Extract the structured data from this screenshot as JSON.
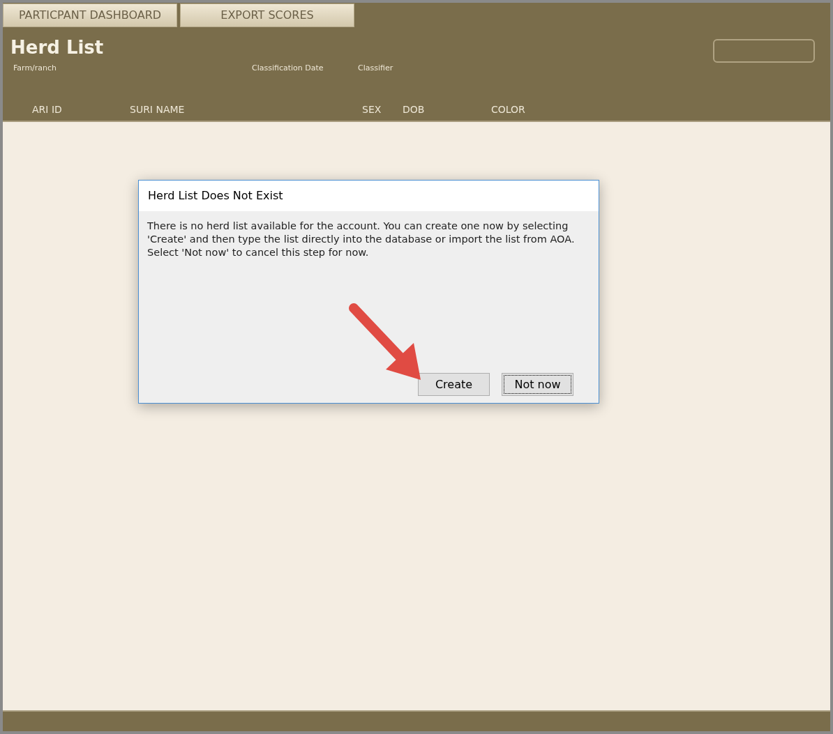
{
  "tabs": [
    {
      "label": "PARTICPANT DASHBOARD"
    },
    {
      "label": "EXPORT SCORES"
    }
  ],
  "title": "Herd List",
  "fields": [
    "Farm/ranch",
    "Classification Date",
    "Classifier"
  ],
  "columns": [
    "ARI ID",
    "SURI NAME",
    "SEX",
    "DOB",
    "COLOR"
  ],
  "dialog": {
    "title": "Herd List Does Not Exist",
    "message": "There is no herd list available for the account. You can create one now by selecting 'Create' and then type the list directly into the database or import the list from AOA.  Select 'Not now' to cancel this step for now.",
    "buttons": [
      {
        "label": "Create",
        "focused": false
      },
      {
        "label": "Not now",
        "focused": true
      }
    ]
  }
}
